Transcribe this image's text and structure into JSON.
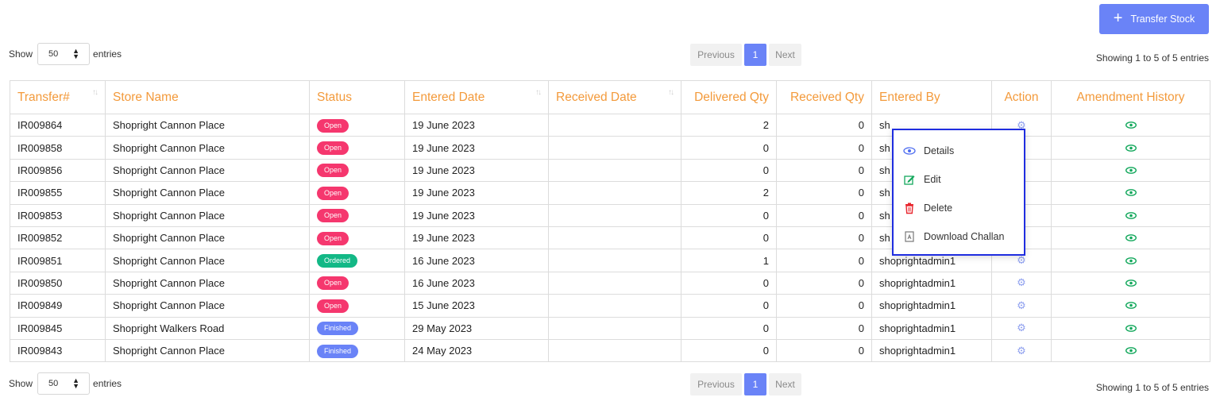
{
  "toolbar": {
    "transfer_stock_label": "Transfer Stock"
  },
  "length_control": {
    "show_label": "Show",
    "entries_label": "entries",
    "selected": "50"
  },
  "pagination": {
    "previous_label": "Previous",
    "current_page": "1",
    "next_label": "Next"
  },
  "info_text": "Showing 1 to 5 of 5 entries",
  "table": {
    "headers": {
      "transfer": "Transfer#",
      "store": "Store Name",
      "status": "Status",
      "entered_date": "Entered Date",
      "received_date": "Received Date",
      "delivered_qty": "Delivered Qty",
      "received_qty": "Received Qty",
      "entered_by": "Entered By",
      "action": "Action",
      "amendment": "Amendment History"
    },
    "rows": [
      {
        "id": "IR009864",
        "store": "Shopright Cannon Place",
        "status": "Open",
        "status_type": "open",
        "entered": "19 June 2023",
        "received": "",
        "delivered_qty": "2",
        "received_qty": "0",
        "entered_by": "sh"
      },
      {
        "id": "IR009858",
        "store": "Shopright Cannon Place",
        "status": "Open",
        "status_type": "open",
        "entered": "19 June 2023",
        "received": "",
        "delivered_qty": "0",
        "received_qty": "0",
        "entered_by": "sh"
      },
      {
        "id": "IR009856",
        "store": "Shopright Cannon Place",
        "status": "Open",
        "status_type": "open",
        "entered": "19 June 2023",
        "received": "",
        "delivered_qty": "0",
        "received_qty": "0",
        "entered_by": "sh"
      },
      {
        "id": "IR009855",
        "store": "Shopright Cannon Place",
        "status": "Open",
        "status_type": "open",
        "entered": "19 June 2023",
        "received": "",
        "delivered_qty": "2",
        "received_qty": "0",
        "entered_by": "sh"
      },
      {
        "id": "IR009853",
        "store": "Shopright Cannon Place",
        "status": "Open",
        "status_type": "open",
        "entered": "19 June 2023",
        "received": "",
        "delivered_qty": "0",
        "received_qty": "0",
        "entered_by": "sh"
      },
      {
        "id": "IR009852",
        "store": "Shopright Cannon Place",
        "status": "Open",
        "status_type": "open",
        "entered": "19 June 2023",
        "received": "",
        "delivered_qty": "0",
        "received_qty": "0",
        "entered_by": "sh"
      },
      {
        "id": "IR009851",
        "store": "Shopright Cannon Place",
        "status": "Ordered",
        "status_type": "ordered",
        "entered": "16 June 2023",
        "received": "",
        "delivered_qty": "1",
        "received_qty": "0",
        "entered_by": "shoprightadmin1"
      },
      {
        "id": "IR009850",
        "store": "Shopright Cannon Place",
        "status": "Open",
        "status_type": "open",
        "entered": "16 June 2023",
        "received": "",
        "delivered_qty": "0",
        "received_qty": "0",
        "entered_by": "shoprightadmin1"
      },
      {
        "id": "IR009849",
        "store": "Shopright Cannon Place",
        "status": "Open",
        "status_type": "open",
        "entered": "15 June 2023",
        "received": "",
        "delivered_qty": "0",
        "received_qty": "0",
        "entered_by": "shoprightadmin1"
      },
      {
        "id": "IR009845",
        "store": "Shopright Walkers Road",
        "status": "Finished",
        "status_type": "finished",
        "entered": "29 May 2023",
        "received": "",
        "delivered_qty": "0",
        "received_qty": "0",
        "entered_by": "shoprightadmin1"
      },
      {
        "id": "IR009843",
        "store": "Shopright Cannon Place",
        "status": "Finished",
        "status_type": "finished",
        "entered": "24 May 2023",
        "received": "",
        "delivered_qty": "0",
        "received_qty": "0",
        "entered_by": "shoprightadmin1"
      }
    ]
  },
  "action_menu": {
    "items": [
      {
        "label": "Details",
        "icon": "eye-icon"
      },
      {
        "label": "Edit",
        "icon": "edit-icon"
      },
      {
        "label": "Delete",
        "icon": "trash-icon"
      },
      {
        "label": "Download Challan",
        "icon": "pdf-icon"
      }
    ]
  },
  "colors": {
    "accent": "#6a83f7",
    "header_text": "#f39a3b",
    "open": "#f5376e",
    "ordered": "#13b886",
    "finished": "#6a83f7",
    "menu_border": "#1f2de0"
  }
}
